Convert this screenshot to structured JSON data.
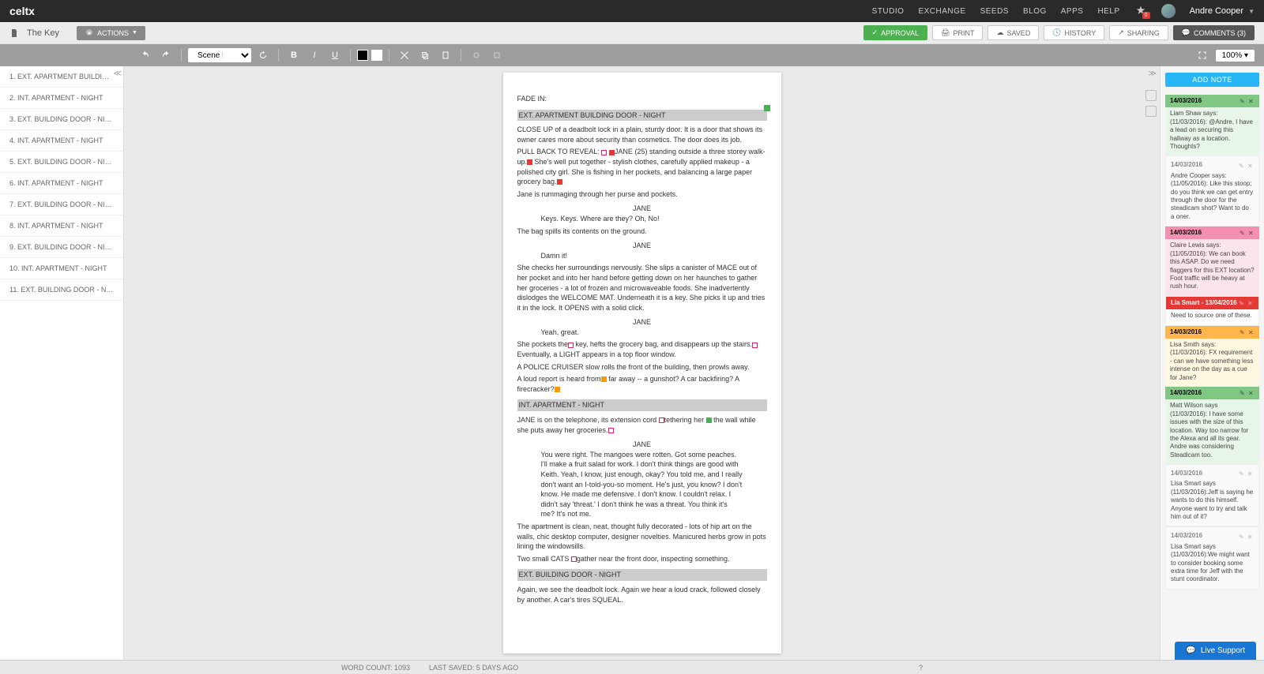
{
  "header": {
    "logo": "celtx",
    "nav": [
      "STUDIO",
      "EXCHANGE",
      "SEEDS",
      "BLOG",
      "APPS",
      "HELP"
    ],
    "notif_count": "0",
    "user_name": "Andre Cooper"
  },
  "subheader": {
    "project_title": "The Key",
    "actions_label": "ACTIONS",
    "buttons": {
      "approval": "APPROVAL",
      "print": "PRINT",
      "saved": "SAVED",
      "history": "HISTORY",
      "sharing": "SHARING",
      "comments": "COMMENTS (3)"
    }
  },
  "toolbar": {
    "element_type": "Scene heading",
    "zoom": "100%",
    "add_note": "ADD NOTE"
  },
  "scenes": [
    {
      "num": "1.",
      "title": "EXT. APARTMENT BUILDING DOOR - ..."
    },
    {
      "num": "2.",
      "title": "INT. APARTMENT - NIGHT"
    },
    {
      "num": "3.",
      "title": "EXT. BUILDING DOOR - NIGHT"
    },
    {
      "num": "4.",
      "title": "INT. APARTMENT - NIGHT"
    },
    {
      "num": "5.",
      "title": "EXT. BUILDING DOOR - NIGHT"
    },
    {
      "num": "6.",
      "title": "INT. APARTMENT - NIGHT"
    },
    {
      "num": "7.",
      "title": "EXT. BUILDING DOOR - NIGHT"
    },
    {
      "num": "8.",
      "title": "INT. APARTMENT - NIGHT"
    },
    {
      "num": "9.",
      "title": "EXT. BUILDING DOOR - NIGHT"
    },
    {
      "num": "10.",
      "title": "INT. APARTMENT - NIGHT"
    },
    {
      "num": "11.",
      "title": "EXT. BUILDING DOOR - NIGHT"
    }
  ],
  "script": {
    "fade_in": "FADE IN:",
    "sh1": "EXT. APARTMENT BUILDING DOOR - NIGHT",
    "a1": "CLOSE UP of a deadbolt lock in a plain, sturdy door. It is a door that shows its owner cares more about security than cosmetics. The door does its job.",
    "a2a": "PULL BACK TO REVEAL: ",
    "a2b": "JANE",
    "a2c": " (25) standing outside a three storey walk-up.",
    "a2d": " She's",
    "a2e": "well put together - stylish clothes, carefully applied makeup - a polished city girl. She is fishing",
    "a2f": " in her pockets, and balancing a large paper grocery bag.",
    "a3": "Jane is rummaging through her purse and pockets.",
    "c1": "JANE",
    "d1": "Keys. Keys. Where are they? Oh, No!",
    "a4": "The bag spills its contents on the ground.",
    "c2": "JANE",
    "d2": "Damn it!",
    "a5": "She checks her surroundings nervously. She slips a canister of MACE out of her pocket and into her hand before getting down on her haunches to gather her groceries - a lot of frozen and microwaveable foods. She inadvertently dislodges the WELCOME MAT. Underneath it is a key. She picks it up and tries it in the lock. It OPENS with a solid click.",
    "c3": "JANE",
    "d3": "Yeah, great.",
    "a6a": "She pockets the",
    "a6b": " key, hefts the grocery bag, and disappears up the stairs.",
    "a6c": " Eventually, a LIGHT appears in a top floor window.",
    "a7": "A POLICE CRUISER slow rolls the front of the building, then prowls away.",
    "a8a": "A loud report is heard from",
    "a8b": " far away -- a gunshot? A car backfiring? A firecracker?",
    "sh2": "INT. APARTMENT - NIGHT",
    "a9a": "JANE is on the telephone, its extension cord ",
    "a9b": "tethering her ",
    "a9c": " the wall while she puts away her groceries.",
    "c4": "JANE",
    "d4": "You were right. The mangoes were rotten. Got some peaches. I'll make a fruit salad for work. I don't think things are good with Keith. Yeah, I know, just enough, okay? You told me, and I really don't want an I-told-you-so moment. He's just, you know? I don't know. He made me defensive. I don't know. I couldn't relax. I didn't say 'threat.' I don't think he was a threat. You think it's me? It's not me.",
    "a10": "The apartment is clean, neat, thought fully decorated - lots of hip art on the walls, chic desktop computer, designer novelties. Manicured herbs grow in pots lining the windowsills.",
    "a11a": "Two small CATS ",
    "a11b": "gather near the front door, inspecting something.",
    "sh3": "EXT. BUILDING DOOR - NIGHT",
    "a12": "Again, we see the deadbolt lock. Again we hear a loud crack, followed closely by another.  A car's tires SQUEAL."
  },
  "notes": [
    {
      "color": "green",
      "date": "14/03/2016",
      "body": "Liam Shaw says: (11/03/2016): @Andre, I have a lead on securing this hallway as a location. Thoughts?"
    },
    {
      "color": "plain",
      "date": "14/03/2016",
      "body": "Andre Cooper says: (11/05/2016): Like this stoop; do you think we can get entry through the door for the steadicam shot? Want to do a oner."
    },
    {
      "color": "pink",
      "date": "14/03/2016",
      "body": "Claire Lewis says: (11/05/2016): We can book this ASAP. Do we need flaggers for this EXT location? Foot traffic will be heavy at rush hour."
    },
    {
      "color": "red",
      "date": "Lia Smart - 13/04/2016",
      "body": "Need to source one of these."
    },
    {
      "color": "orange",
      "date": "14/03/2016",
      "body": "Lisa Smith says: (11/03/2016): FX requirement - can we have something less intense on the day as a cue for Jane?"
    },
    {
      "color": "green",
      "date": "14/03/2016",
      "body": "Matt Wilson says (11/03/2016): I have some issues with the size of this location. Way too narrow for the Alexa and all its gear. Andre was considering Steadicam too."
    },
    {
      "color": "plain",
      "date": "14/03/2016",
      "body": "Lisa Smart says (11/03/2016):Jeff is saying he wants to do this himself. Anyone want to try and talk him out of it?"
    },
    {
      "color": "plain",
      "date": "14/03/2016",
      "body": "Lisa Smart says (11/03/2016):We might want to consider booking some extra time for Jeff with the stunt coordinator."
    }
  ],
  "status": {
    "word_count": "WORD COUNT: 1093",
    "last_saved": "LAST SAVED: 5 DAYS AGO",
    "help": "?",
    "live_support": "Live Support"
  }
}
